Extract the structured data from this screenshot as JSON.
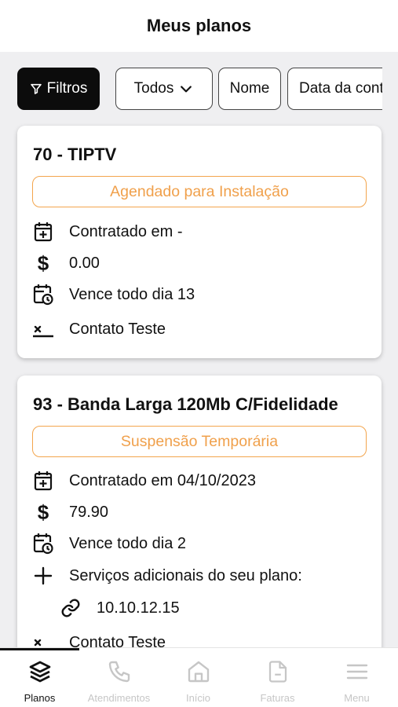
{
  "header": {
    "title": "Meus planos"
  },
  "filters": {
    "filter_button": "Filtros",
    "all_chip": "Todos",
    "name_chip": "Nome",
    "date_chip": "Data da contratação"
  },
  "plans": [
    {
      "title": "70 - TIPTV",
      "status": "Agendado para Instalação",
      "contracted": "Contratado em -",
      "price": "0.00",
      "due": "Vence todo dia 13",
      "contact": "Contato Teste"
    },
    {
      "title": "93 - Banda Larga 120Mb C/Fidelidade",
      "status": "Suspensão Temporária",
      "contracted": "Contratado em 04/10/2023",
      "price": "79.90",
      "due": "Vence todo dia 2",
      "extras_label": "Serviços adicionais do seu plano:",
      "extra_ip": "10.10.12.15",
      "contact": "Contato Teste"
    }
  ],
  "nav": {
    "items": [
      {
        "label": "Planos",
        "active": true
      },
      {
        "label": "Atendimentos"
      },
      {
        "label": "Início"
      },
      {
        "label": "Faturas"
      },
      {
        "label": "Menu"
      }
    ]
  },
  "colors": {
    "accent": "#f0a04b",
    "active": "#111111",
    "inactive": "#c6c6c6"
  }
}
